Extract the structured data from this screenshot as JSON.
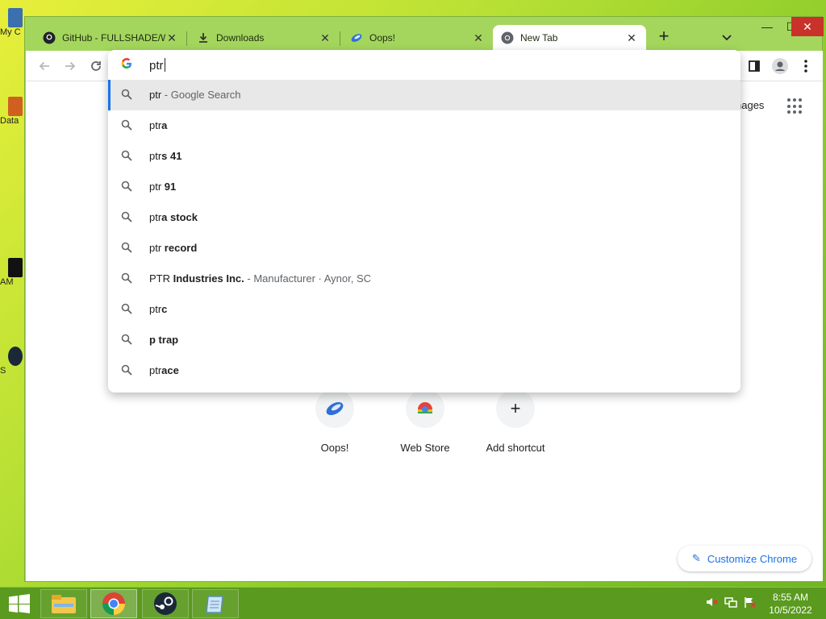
{
  "desktop": {
    "icons": [
      "My C",
      "Data",
      "AM",
      "S"
    ]
  },
  "tabs": [
    {
      "title": "GitHub - FULLSHADE/Wi",
      "icon": "github-icon"
    },
    {
      "title": "Downloads",
      "icon": "download-icon"
    },
    {
      "title": "Oops!",
      "icon": "oops-icon"
    },
    {
      "title": "New Tab",
      "icon": "chrome-icon",
      "active": true
    }
  ],
  "omnibox": {
    "value": "ptr",
    "suggestions": [
      {
        "typed": "ptr",
        "bold": "",
        "desc": " - Google Search"
      },
      {
        "typed": "ptr",
        "bold": "a",
        "desc": ""
      },
      {
        "typed": "ptr",
        "bold": "s 41",
        "desc": ""
      },
      {
        "typed": "ptr ",
        "bold": "91",
        "desc": ""
      },
      {
        "typed": "ptr",
        "bold": "a stock",
        "desc": ""
      },
      {
        "typed": "ptr ",
        "bold": "record",
        "desc": ""
      },
      {
        "typed": "PTR ",
        "bold": "Industries Inc.",
        "desc": " - Manufacturer · Aynor, SC"
      },
      {
        "typed": "ptr",
        "bold": "c",
        "desc": ""
      },
      {
        "typed": "",
        "bold": "p trap",
        "desc": ""
      },
      {
        "typed": "ptr",
        "bold": "ace",
        "desc": ""
      }
    ]
  },
  "newtab": {
    "images_link": "nages",
    "shortcuts": [
      {
        "label": "Oops!"
      },
      {
        "label": "Web Store"
      },
      {
        "label": "Add shortcut"
      }
    ],
    "customize_label": "Customize Chrome"
  },
  "taskbar": {
    "time": "8:55 AM",
    "date": "10/5/2022"
  },
  "colors": {
    "accent": "#1a73e8",
    "window_frame": "#a4d65e",
    "taskbar": "#5a9a1e"
  }
}
